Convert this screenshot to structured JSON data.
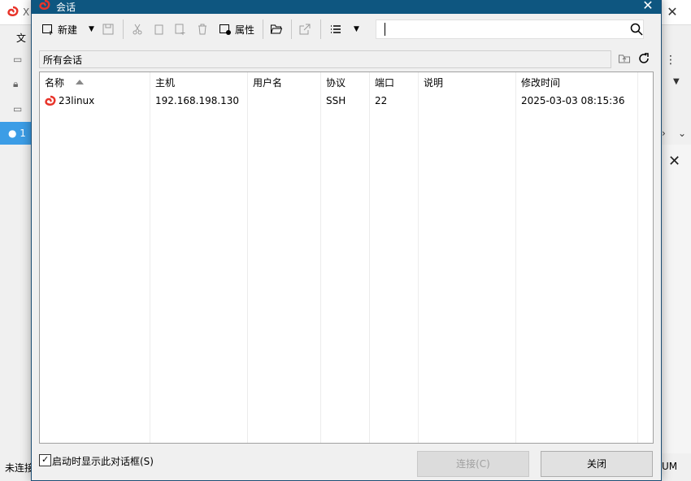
{
  "background_app": {
    "title_partial": "X",
    "menu_partial": "文",
    "session_tab_partial": "1",
    "status_left": "未连接",
    "status_right": "UM"
  },
  "dialog": {
    "title": "会话",
    "toolbar": {
      "new_label": "新建",
      "properties_label": "属性"
    },
    "search": {
      "value": ""
    },
    "breadcrumb": "所有会话",
    "table": {
      "columns": [
        "名称",
        "主机",
        "用户名",
        "协议",
        "端口",
        "说明",
        "修改时间"
      ],
      "rows": [
        {
          "name": "23linux",
          "host": "192.168.198.130",
          "user": "",
          "protocol": "SSH",
          "port": "22",
          "description": "",
          "modified": "2025-03-03 08:15:36"
        }
      ]
    },
    "footer": {
      "show_on_startup_label": "启动时显示此对话框(S)",
      "show_on_startup_checked": true,
      "connect_label": "连接(C)",
      "close_label": "关闭"
    }
  },
  "colors": {
    "title_bar": "#0e5680",
    "brand_red": "#e8342a",
    "session_bar": "#3c9de6"
  }
}
